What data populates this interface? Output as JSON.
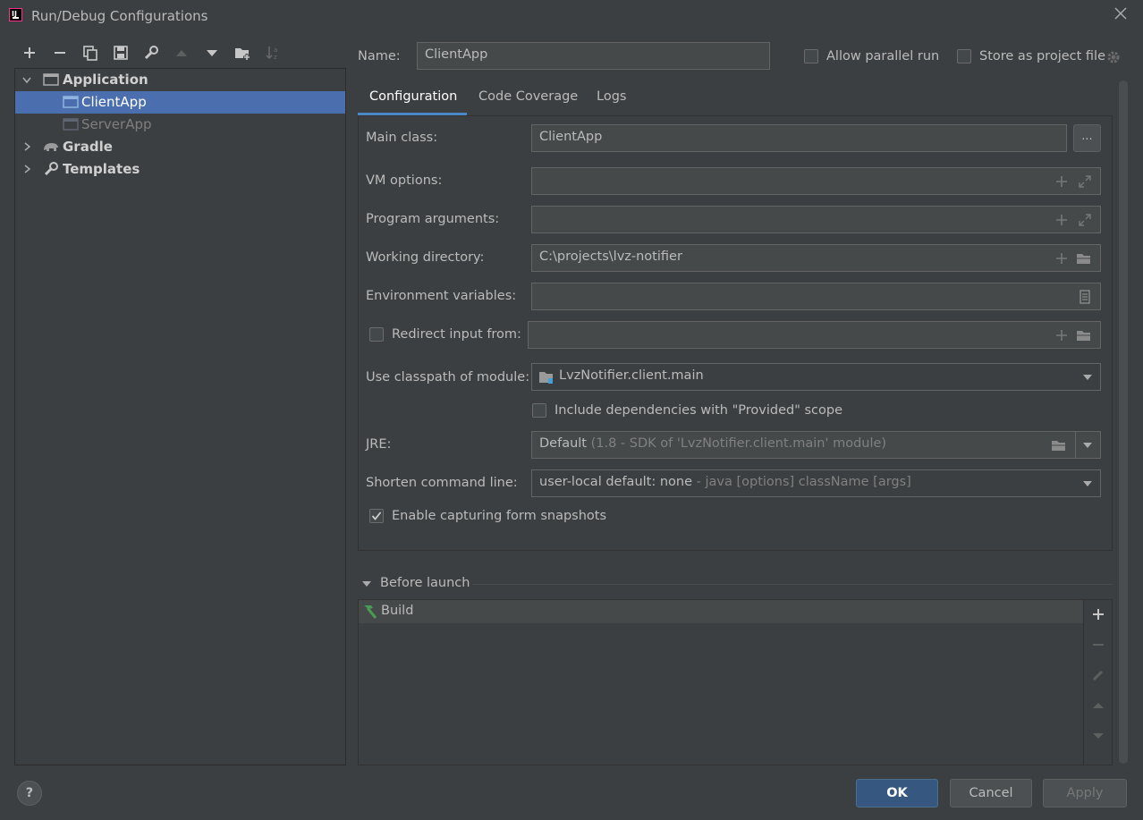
{
  "window": {
    "title": "Run/Debug Configurations"
  },
  "colors": {
    "selection": "#4b6eaf",
    "primary_button": "#365880",
    "build_icon": "#499c54"
  },
  "toolbar": {
    "icons": [
      "add-icon",
      "remove-icon",
      "copy-icon",
      "save-icon",
      "wrench-icon",
      "move-up-icon",
      "move-down-icon",
      "new-folder-icon",
      "sort-icon"
    ]
  },
  "tree": {
    "application": "Application",
    "client_app": "ClientApp",
    "server_app": "ServerApp",
    "gradle": "Gradle",
    "templates": "Templates"
  },
  "header": {
    "name_label": "Name:",
    "name_value": "ClientApp",
    "allow_parallel": "Allow parallel run",
    "store_project": "Store as project file"
  },
  "tabs": [
    "Configuration",
    "Code Coverage",
    "Logs"
  ],
  "form": {
    "main_class_label": "Main class:",
    "main_class_value": "ClientApp",
    "browse_label": "...",
    "vm_options_label": "VM options:",
    "program_args_label": "Program arguments:",
    "working_dir_label": "Working directory:",
    "working_dir_value": "C:\\projects\\lvz-notifier",
    "env_vars_label": "Environment variables:",
    "redirect_input_label": "Redirect input from:",
    "classpath_label": "Use classpath of module:",
    "classpath_value": "LvzNotifier.client.main",
    "include_deps_label": "Include dependencies with \"Provided\" scope",
    "jre_label": "JRE:",
    "jre_value": "Default",
    "jre_hint": "(1.8 - SDK of 'LvzNotifier.client.main' module)",
    "shorten_label": "Shorten command line:",
    "shorten_value": "user-local default: none",
    "shorten_hint": "- java [options] className [args]",
    "snapshots_label": "Enable capturing form snapshots",
    "snapshots_checked": true
  },
  "before_launch": {
    "title": "Before launch",
    "items": [
      "Build"
    ]
  },
  "buttons": {
    "ok": "OK",
    "cancel": "Cancel",
    "apply": "Apply",
    "help": "?"
  }
}
